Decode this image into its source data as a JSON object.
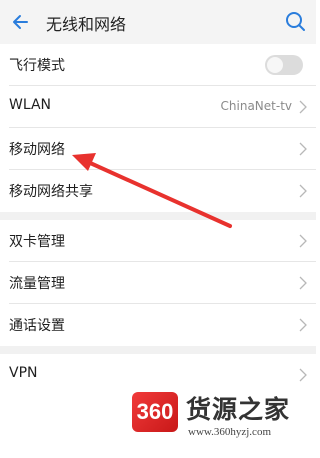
{
  "header": {
    "title": "无线和网络",
    "back_icon": "arrow-left-icon",
    "search_icon": "search-icon"
  },
  "settings": [
    {
      "label": "飞行模式",
      "toggle_on": false
    },
    {
      "label": "WLAN",
      "value": "ChinaNet-tv"
    },
    {
      "label": "移动网络"
    },
    {
      "label": "移动网络共享"
    },
    {
      "label": "双卡管理"
    },
    {
      "label": "流量管理"
    },
    {
      "label": "通话设置"
    },
    {
      "label": "VPN"
    }
  ],
  "watermark": {
    "logo_text": "360",
    "name": "货源之家",
    "url": "www.360hyzj.com"
  },
  "colors": {
    "accent": "#2a7ddc",
    "arrow": "#e8322e",
    "header_bg": "#f4f4f4",
    "section_gap": "#f1f1f1"
  }
}
